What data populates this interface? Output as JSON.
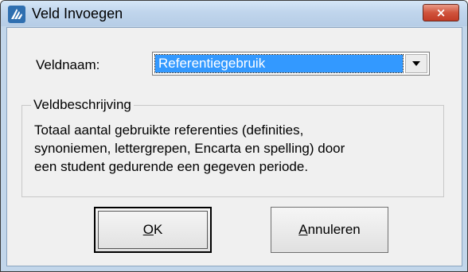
{
  "window": {
    "title": "Veld Invoegen",
    "close_glyph": "×"
  },
  "field": {
    "label": "Veldnaam:",
    "selected_value": "Referentiegebruik"
  },
  "description_group": {
    "title": "Veldbeschrijving",
    "lines": [
      "Totaal aantal gebruikte referenties (definities,",
      "synoniemen, lettergrepen, Encarta en spelling) door",
      "een student gedurende een gegeven periode."
    ]
  },
  "buttons": {
    "ok_mnemonic": "O",
    "ok_rest": "K",
    "cancel_mnemonic": "A",
    "cancel_rest": "nnuleren"
  },
  "icons": {
    "app": "app-logo-icon",
    "close": "close-icon",
    "dropdown": "chevron-down-icon"
  },
  "colors": {
    "selection": "#3399ff",
    "close_button": "#c8432b"
  }
}
